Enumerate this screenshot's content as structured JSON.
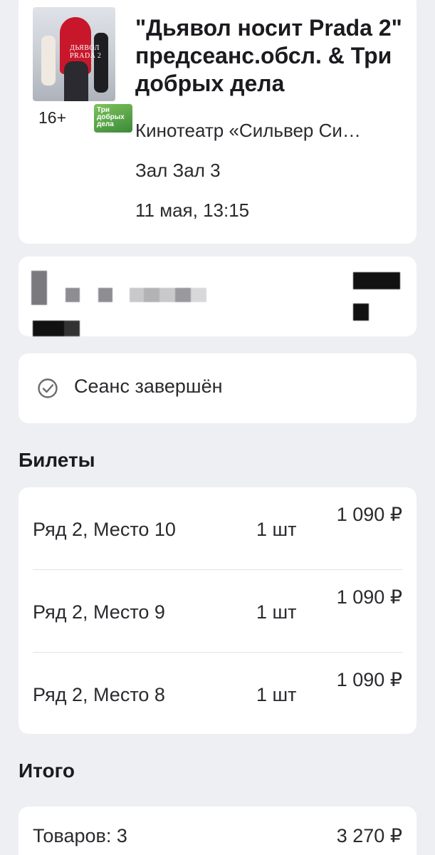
{
  "movie": {
    "title": "\"Дьявол носит Prada 2\" предсеанс.обсл. & Три добрых дела",
    "poster_text": "ДЬЯВОЛ PRADA 2",
    "age_rating": "16+",
    "mini_poster_text": "Три добрых дела",
    "cinema": "Кинотеатр «Сильвер Си…",
    "hall": "Зал Зал 3",
    "datetime": "11 мая, 13:15"
  },
  "status": {
    "icon": "check-circle-icon",
    "text": "Сеанс завершён"
  },
  "tickets_section": {
    "title": "Билеты",
    "items": [
      {
        "seat": "Ряд 2, Место 10",
        "qty": "1 шт",
        "price": "1 090 ₽"
      },
      {
        "seat": "Ряд 2, Место 9",
        "qty": "1 шт",
        "price": "1 090 ₽"
      },
      {
        "seat": "Ряд 2, Место 8",
        "qty": "1 шт",
        "price": "1 090 ₽"
      }
    ]
  },
  "total_section": {
    "title": "Итого",
    "items_label": "Товаров: 3",
    "amount": "3 270 ₽"
  },
  "colors": {
    "background": "#eeeff3",
    "card": "#ffffff",
    "text": "#1b1b1f",
    "icon": "#6b6b70"
  }
}
